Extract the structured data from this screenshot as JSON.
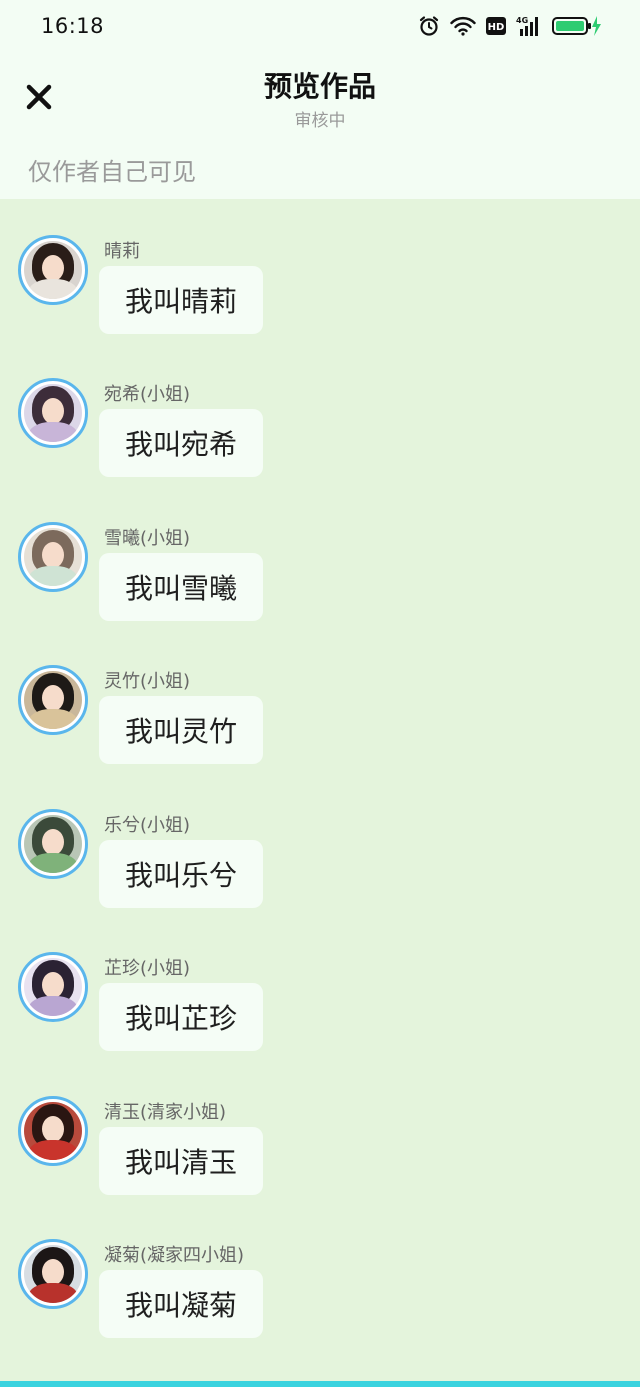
{
  "status_bar": {
    "time": "16:18",
    "network_type": "4G",
    "hd_label": "HD"
  },
  "header": {
    "title": "预览作品",
    "subtitle": "审核中",
    "visibility_note": "仅作者自己可见"
  },
  "colors": {
    "header_background": "#f3fdf4",
    "chat_background": "#e4f4dc",
    "avatar_ring": "#5ab6ec",
    "bubble_background": "#f5fdf6",
    "battery_green": "#2ecc71",
    "bottom_bar": "#3bd3df"
  },
  "messages": [
    {
      "sender": "晴莉",
      "text": "我叫晴莉",
      "avatar_colors": {
        "hair": "#2a1d18",
        "robe": "#e9e4dd",
        "bg": "#d9d4cf"
      }
    },
    {
      "sender": "宛希(小姐)",
      "text": "我叫宛希",
      "avatar_colors": {
        "hair": "#3d2d3a",
        "robe": "#c8b5d8",
        "bg": "#dcd7e8"
      }
    },
    {
      "sender": "雪曦(小姐)",
      "text": "我叫雪曦",
      "avatar_colors": {
        "hair": "#7c6a5c",
        "robe": "#cfe3d4",
        "bg": "#e6e0d6"
      }
    },
    {
      "sender": "灵竹(小姐)",
      "text": "我叫灵竹",
      "avatar_colors": {
        "hair": "#1e1a17",
        "robe": "#d9c39a",
        "bg": "#c9b79a"
      }
    },
    {
      "sender": "乐兮(小姐)",
      "text": "我叫乐兮",
      "avatar_colors": {
        "hair": "#3b4a3a",
        "robe": "#7fb27a",
        "bg": "#b9c6b6"
      }
    },
    {
      "sender": "芷珍(小姐)",
      "text": "我叫芷珍",
      "avatar_colors": {
        "hair": "#2b2233",
        "robe": "#b9a6d2",
        "bg": "#e8e2f0"
      }
    },
    {
      "sender": "清玉(清家小姐)",
      "text": "我叫清玉",
      "avatar_colors": {
        "hair": "#2a1612",
        "robe": "#c9342c",
        "bg": "#b84a3c"
      }
    },
    {
      "sender": "凝菊(凝家四小姐)",
      "text": "我叫凝菊",
      "avatar_colors": {
        "hair": "#1c1616",
        "robe": "#b8322c",
        "bg": "#d7dde3"
      }
    }
  ]
}
